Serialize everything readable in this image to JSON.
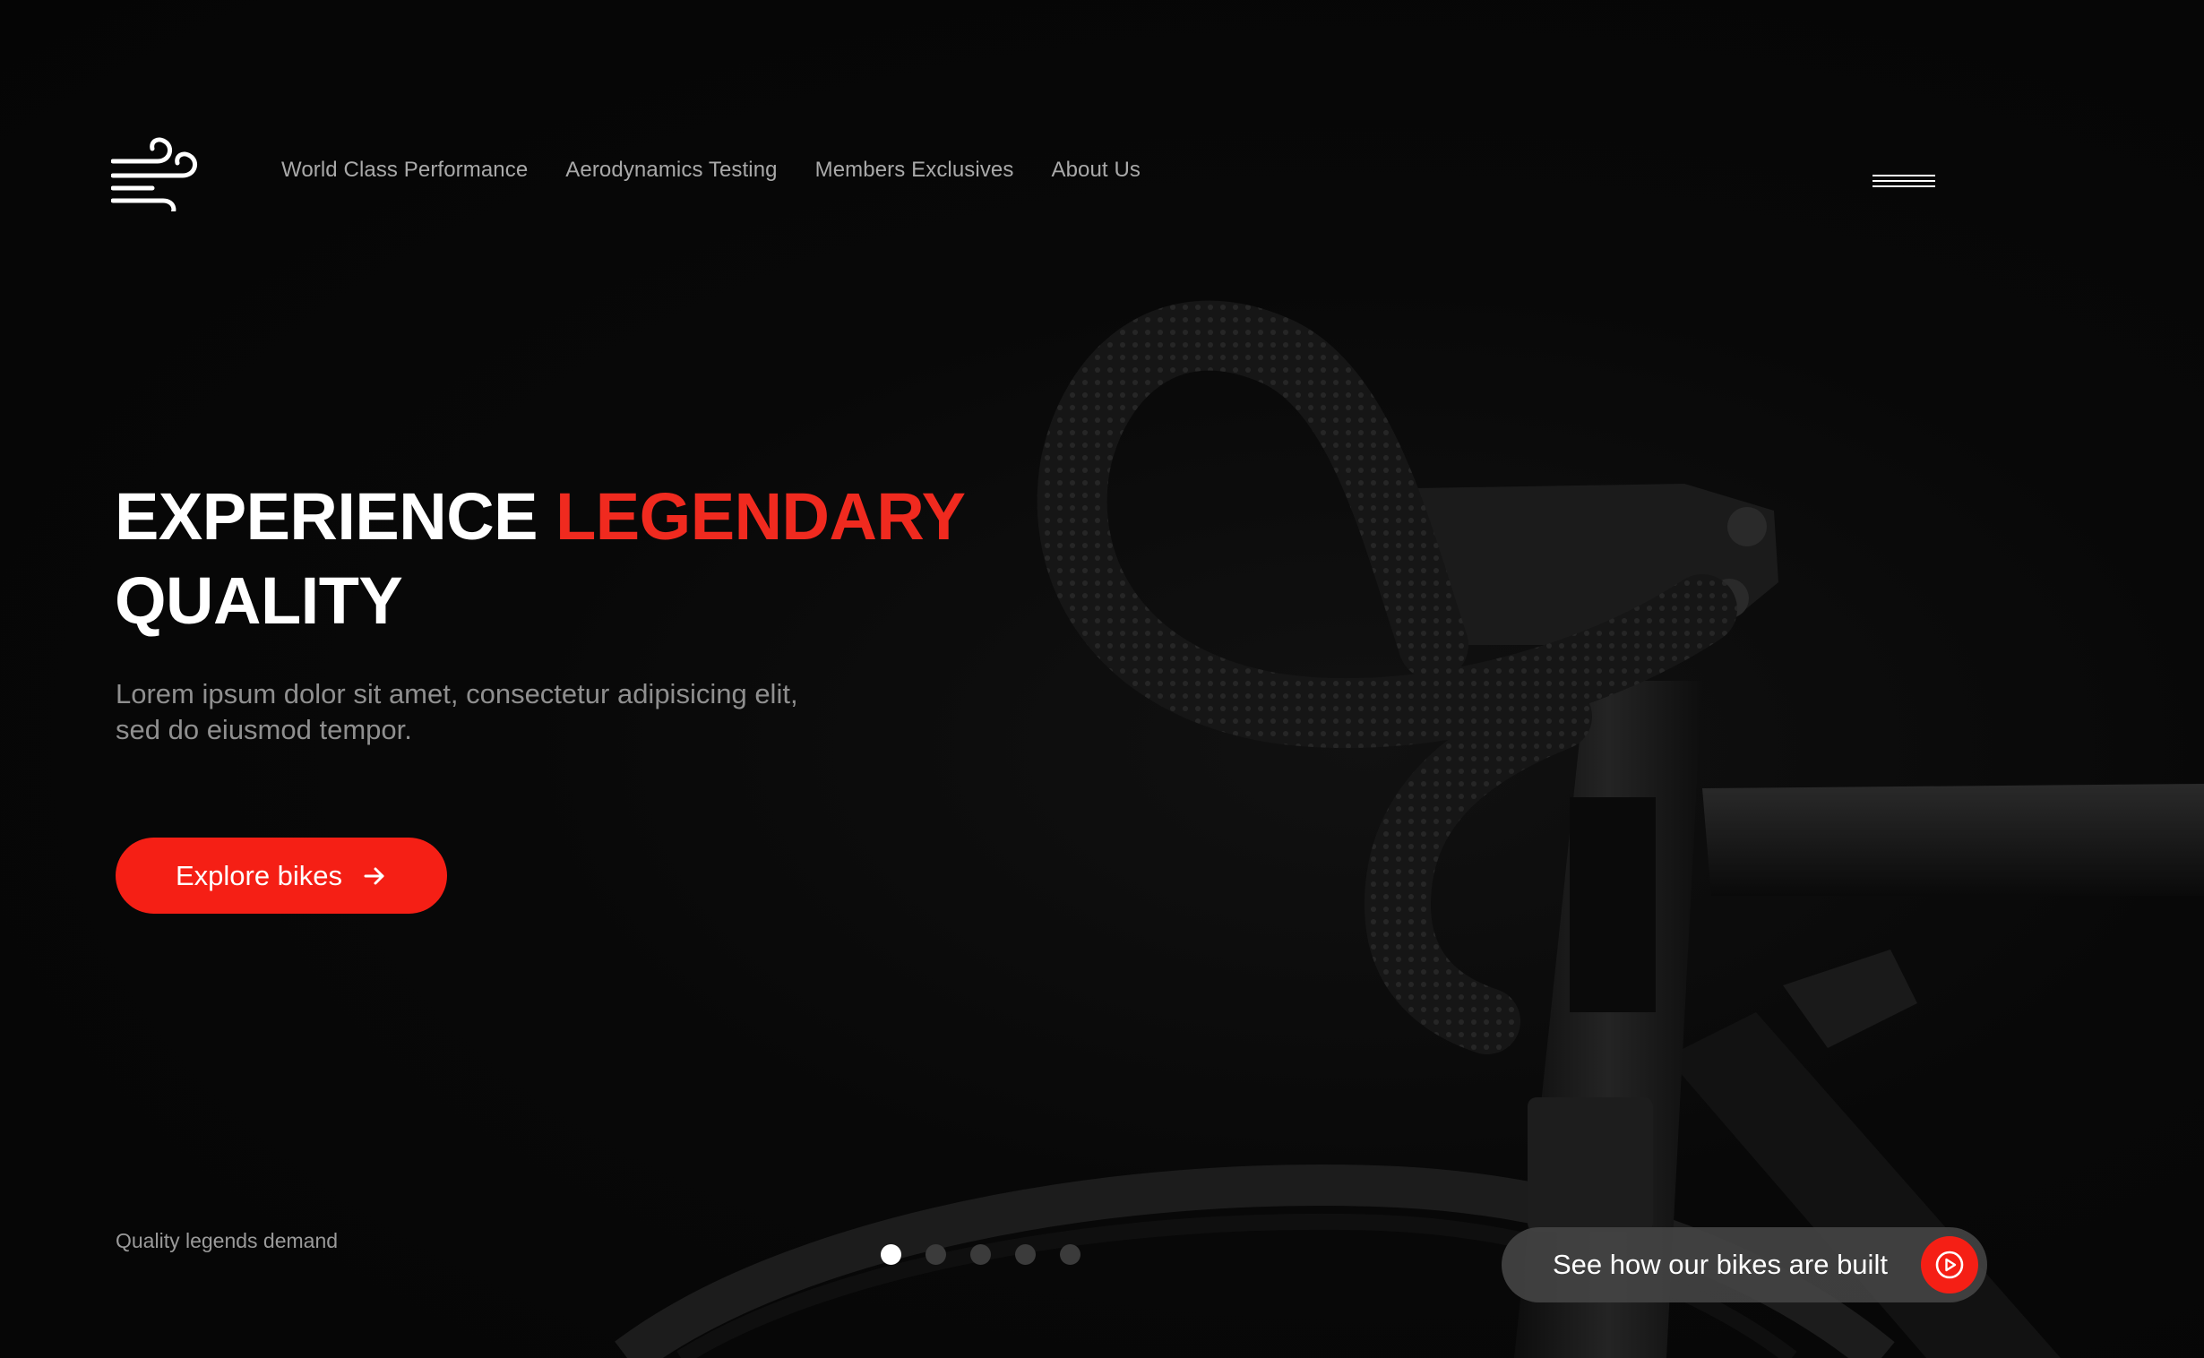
{
  "nav": {
    "items": [
      {
        "label": "World Class Performance"
      },
      {
        "label": "Aerodynamics Testing"
      },
      {
        "label": "Members Exclusives"
      },
      {
        "label": "About Us"
      }
    ],
    "logo_icon": "wind-icon",
    "menu_icon": "hamburger-menu-icon"
  },
  "hero": {
    "title_line1_white": "EXPERIENCE ",
    "title_line1_accent": "LEGENDARY",
    "title_line2": "QUALITY",
    "subtitle": "Lorem ipsum dolor sit amet, consectetur adipisicing elit, sed do eiusmod tempor.",
    "cta_label": "Explore bikes",
    "cta_icon": "arrow-right-icon"
  },
  "footer": {
    "tagline": "Quality legends demand"
  },
  "carousel": {
    "total": 5,
    "active_index": 1
  },
  "video_cta": {
    "label": "See how our bikes are built",
    "icon": "play-circle-icon"
  },
  "colors": {
    "background": "#060606",
    "accent": "#f51f15",
    "text_primary": "#ffffff",
    "text_muted": "#9a9a9a"
  }
}
